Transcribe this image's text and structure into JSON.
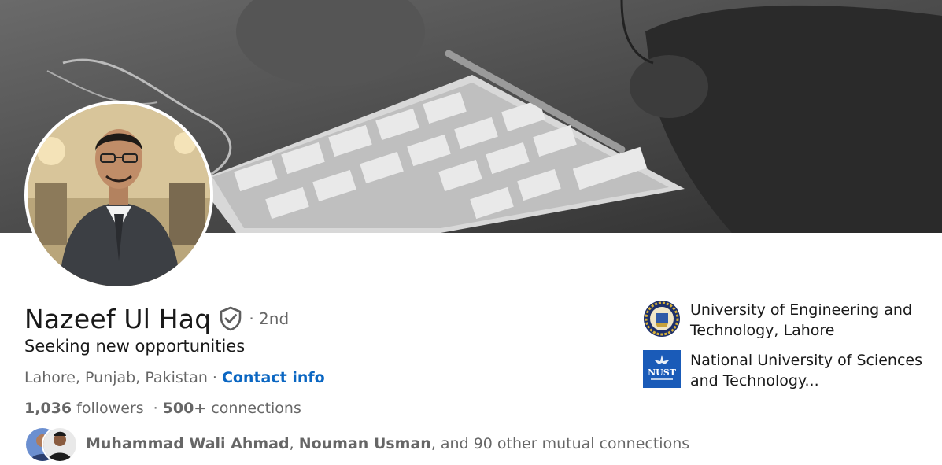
{
  "profile": {
    "name": "Nazeef Ul Haq",
    "degree": "· 2nd",
    "headline": "Seeking new opportunities",
    "location": "Lahore, Punjab, Pakistan",
    "location_sep": "·",
    "contact_label": "Contact info",
    "followers_count": "1,036",
    "followers_label": "followers",
    "connections_count": "500+",
    "connections_label": "connections",
    "stats_sep": "·"
  },
  "mutual": {
    "name1": "Muhammad Wali Ahmad",
    "comma": ",",
    "name2": "Nouman Usman",
    "rest": ", and 90 other mutual connections"
  },
  "education": [
    {
      "name": "University of Engineering and Technology, Lahore",
      "logo_icon": "uet-logo-icon"
    },
    {
      "name": "National University of Sciences and Technology...",
      "logo_icon": "nust-logo-icon",
      "logo_text": "NUST"
    }
  ],
  "colors": {
    "link": "#0a66c2",
    "nust_blue": "#1a5bb8",
    "text_secondary": "#666666"
  }
}
